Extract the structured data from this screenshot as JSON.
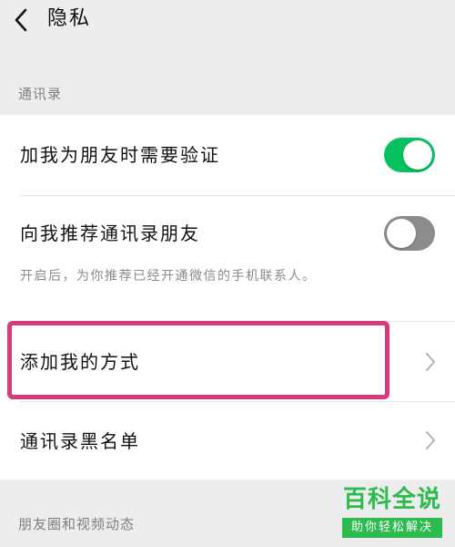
{
  "header": {
    "title": "隐私"
  },
  "sections": {
    "contacts": {
      "label": "通讯录",
      "items": {
        "verify": {
          "label": "加我为朋友时需要验证",
          "on": true
        },
        "recommend": {
          "label": "向我推荐通讯录朋友",
          "on": false,
          "desc": "开启后，为你推荐已经开通微信的手机联系人。"
        },
        "add_methods": {
          "label": "添加我的方式"
        },
        "blacklist": {
          "label": "通讯录黑名单"
        }
      }
    },
    "moments": {
      "label": "朋友圈和视频动态"
    }
  },
  "watermark": {
    "main": "百科全说",
    "sub": "助你轻松解决"
  },
  "colors": {
    "toggle_on": "#07c160",
    "toggle_off": "#8c8c8c",
    "highlight": "#d63a78",
    "watermark": "#2dbb4f"
  }
}
